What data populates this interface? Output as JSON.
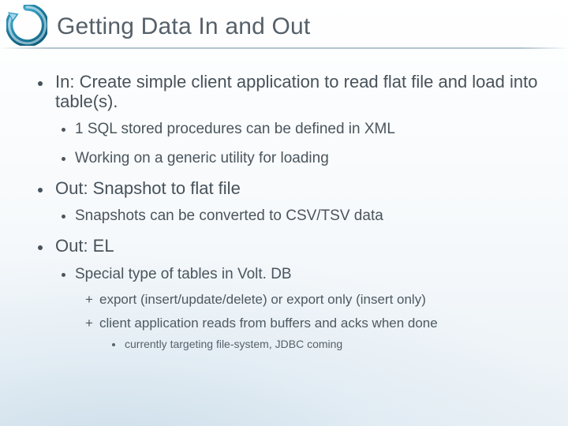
{
  "header": {
    "title": "Getting Data In and Out"
  },
  "bullets": [
    {
      "text": "In: Create simple client application to read flat file and load into table(s).",
      "children": [
        {
          "text": "1 SQL stored procedures can be defined in XML"
        },
        {
          "text": "Working on a generic utility for loading"
        }
      ]
    },
    {
      "text": "Out: Snapshot to flat file",
      "children": [
        {
          "text": "Snapshots can be converted to CSV/TSV data"
        }
      ]
    },
    {
      "text": "Out: EL",
      "children": [
        {
          "text": "Special type of tables in Volt. DB",
          "children": [
            {
              "marker": "+",
              "text": "export (insert/update/delete) or export only (insert only)"
            },
            {
              "marker": "+",
              "text": "client application reads from buffers and acks when done",
              "children": [
                {
                  "text": "currently targeting file-system, JDBC coming"
                }
              ]
            }
          ]
        }
      ]
    }
  ]
}
